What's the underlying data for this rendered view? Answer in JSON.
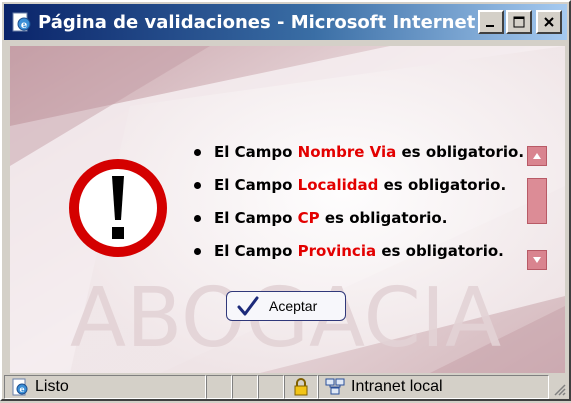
{
  "window": {
    "title": "Página de validaciones - Microsoft Internet Ex...",
    "title_icon": "ie-page-icon",
    "controls": [
      "minimize",
      "maximize",
      "close"
    ]
  },
  "dialog": {
    "watermark_text": "ABOGACIA",
    "warning_icon": "exclamation-icon",
    "messages": [
      {
        "prefix": "El Campo ",
        "field": "Nombre Via",
        "suffix": " es obligatorio."
      },
      {
        "prefix": "El Campo ",
        "field": "Localidad",
        "suffix": " es obligatorio."
      },
      {
        "prefix": "El Campo ",
        "field": "CP",
        "suffix": " es obligatorio."
      },
      {
        "prefix": "El Campo ",
        "field": "Provincia",
        "suffix": " es obligatorio."
      }
    ],
    "accept_label": "Aceptar"
  },
  "statusbar": {
    "status_text": "Listo",
    "zone_text": "Intranet local"
  },
  "colors": {
    "field_highlight": "#e30000",
    "title_gradient_start": "#0a246a",
    "title_gradient_end": "#a6caf0",
    "scroll_accent": "#d9848f",
    "warning_red": "#d40000"
  }
}
